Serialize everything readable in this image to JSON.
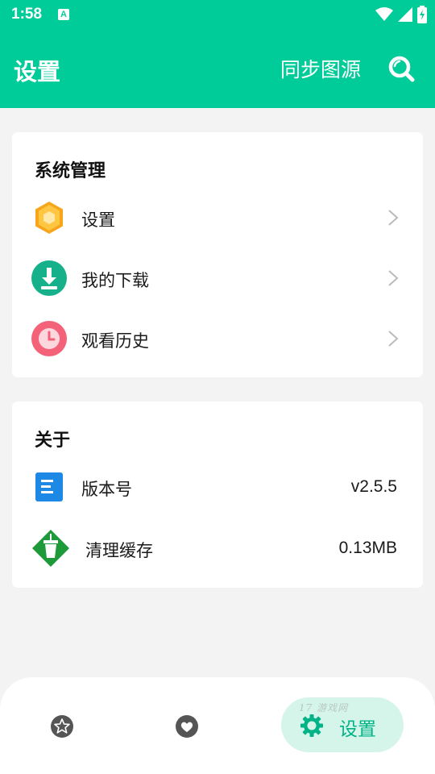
{
  "status_bar": {
    "time": "1:58",
    "notification_icon_letter": "A",
    "icons": [
      "wifi-icon",
      "signal-icon",
      "battery-charging-icon"
    ]
  },
  "header": {
    "title": "设置",
    "sync_label": "同步图源",
    "search_icon": "search-icon",
    "background_color": "#00cc99"
  },
  "system_section": {
    "title": "系统管理",
    "items": [
      {
        "label": "设置",
        "icon": "hexagon-settings-icon"
      },
      {
        "label": "我的下载",
        "icon": "download-icon"
      },
      {
        "label": "观看历史",
        "icon": "clock-history-icon"
      }
    ]
  },
  "about_section": {
    "title": "关于",
    "items": [
      {
        "label": "版本号",
        "value": "v2.5.5",
        "icon": "document-icon"
      },
      {
        "label": "清理缓存",
        "value": "0.13MB",
        "icon": "cup-cache-icon"
      }
    ]
  },
  "bottom_nav": {
    "items": [
      {
        "icon": "star-icon"
      },
      {
        "icon": "heart-icon"
      },
      {
        "icon": "gear-icon",
        "label": "设置",
        "active": true
      }
    ],
    "watermark": "17 游戏网"
  }
}
